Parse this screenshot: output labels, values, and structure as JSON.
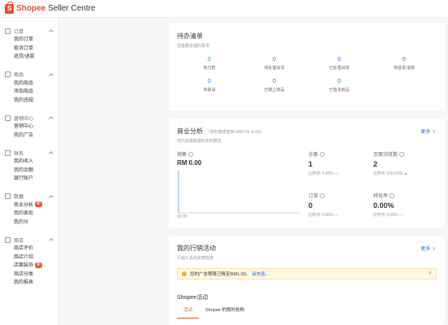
{
  "header": {
    "brand": "Shopee",
    "subtitle": "Seller Centre"
  },
  "sidebar": {
    "sections": [
      {
        "title": "订单",
        "items": [
          "我的订单",
          "取消订单",
          "退货/退款"
        ]
      },
      {
        "title": "商品",
        "items": [
          "我的商品",
          "添加商品",
          "我的违规"
        ]
      },
      {
        "title": "营销中心",
        "items": [
          "营销中心",
          "我的广告"
        ]
      },
      {
        "title": "财务",
        "items": [
          "我的收入",
          "我的余额",
          "银行账户"
        ]
      },
      {
        "title": "数据",
        "items": [
          "商业分析",
          "我的表现",
          "我的分"
        ]
      },
      {
        "title": "商店",
        "items": [
          "商店评价",
          "商店介绍",
          "店面装饰",
          "商店分类",
          "我的报表"
        ]
      }
    ],
    "badge_new": "新"
  },
  "todo": {
    "title": "待办清单",
    "subtitle": "您需要处理的事项",
    "items": [
      {
        "value": "0",
        "label": "未付款"
      },
      {
        "value": "0",
        "label": "待处理出货"
      },
      {
        "value": "0",
        "label": "已处理出货"
      },
      {
        "value": "0",
        "label": "待退货/退款"
      },
      {
        "value": "0",
        "label": "待取消"
      },
      {
        "value": "0",
        "label": "已禁止商品"
      },
      {
        "value": "0",
        "label": "已售完商品"
      }
    ]
  },
  "analytics": {
    "title": "商业分析",
    "range": "（实时数据直到 GMT+8 11:00）",
    "subtitle": "店内关键数据的实时概览",
    "more": "更多",
    "sales_label": "销售",
    "sales_value": "RM 0.00",
    "chart_date": "00:00",
    "metrics": [
      {
        "label": "访客",
        "value": "1",
        "compare": "比昨天 0.00% —"
      },
      {
        "label": "页面浏览数",
        "value": "2",
        "compare": "比昨天 100.00% ▲"
      },
      {
        "label": "订单",
        "value": "0",
        "compare": "比昨天 0.00% —"
      },
      {
        "label": "转化率",
        "value": "0.00%",
        "compare": "比昨天 0.00% —"
      }
    ]
  },
  "marketing": {
    "title": "我的行销活动",
    "subtitle": "行销工具的实用指南",
    "more": "更多",
    "notice_text": "您的广告预算已降至RM1.00。",
    "notice_link": "请充值。",
    "section_name": "Shopee活动",
    "tabs": [
      "活动",
      "Shopee 的限时抢购"
    ]
  }
}
